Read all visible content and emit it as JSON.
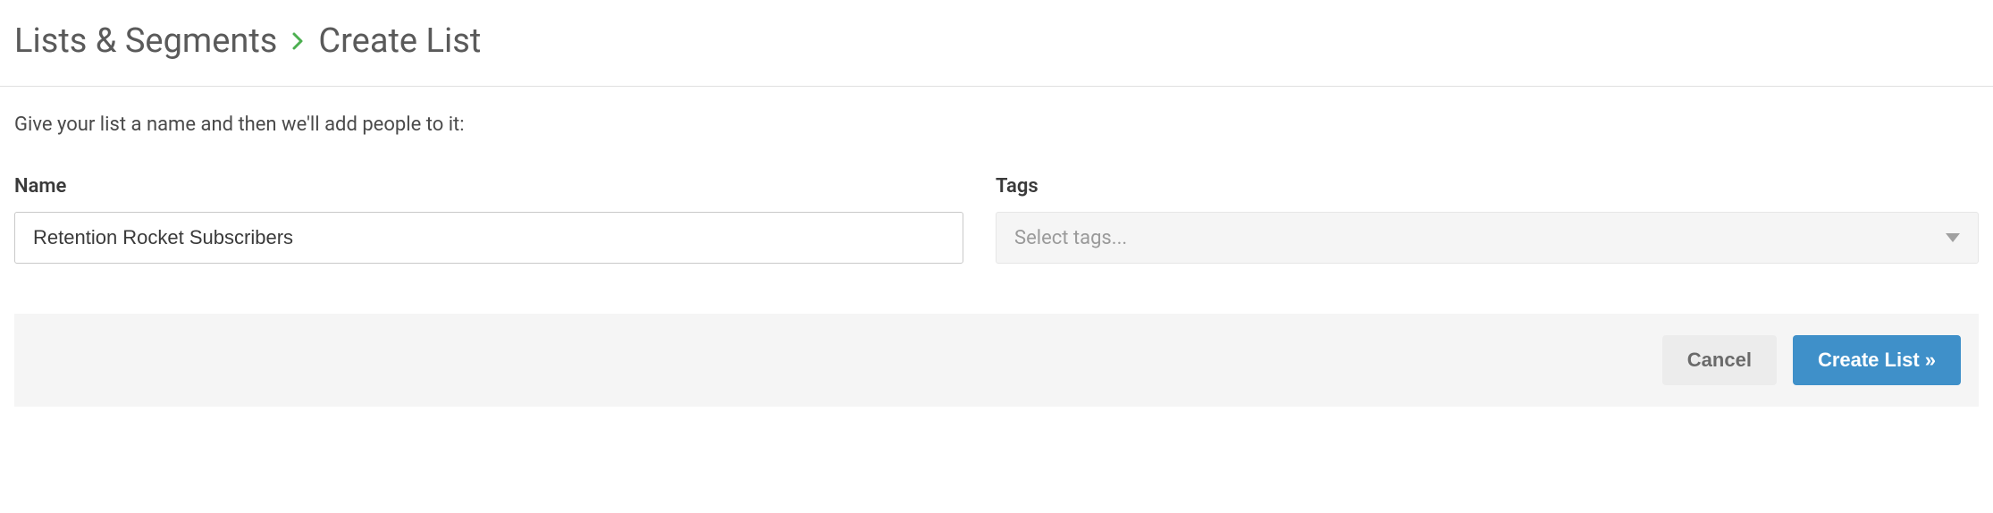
{
  "breadcrumb": {
    "parent": "Lists & Segments",
    "current": "Create List"
  },
  "instruction": "Give your list a name and then we'll add people to it:",
  "form": {
    "name": {
      "label": "Name",
      "value": "Retention Rocket Subscribers"
    },
    "tags": {
      "label": "Tags",
      "placeholder": "Select tags..."
    }
  },
  "actions": {
    "cancel": "Cancel",
    "submit": "Create List »"
  }
}
